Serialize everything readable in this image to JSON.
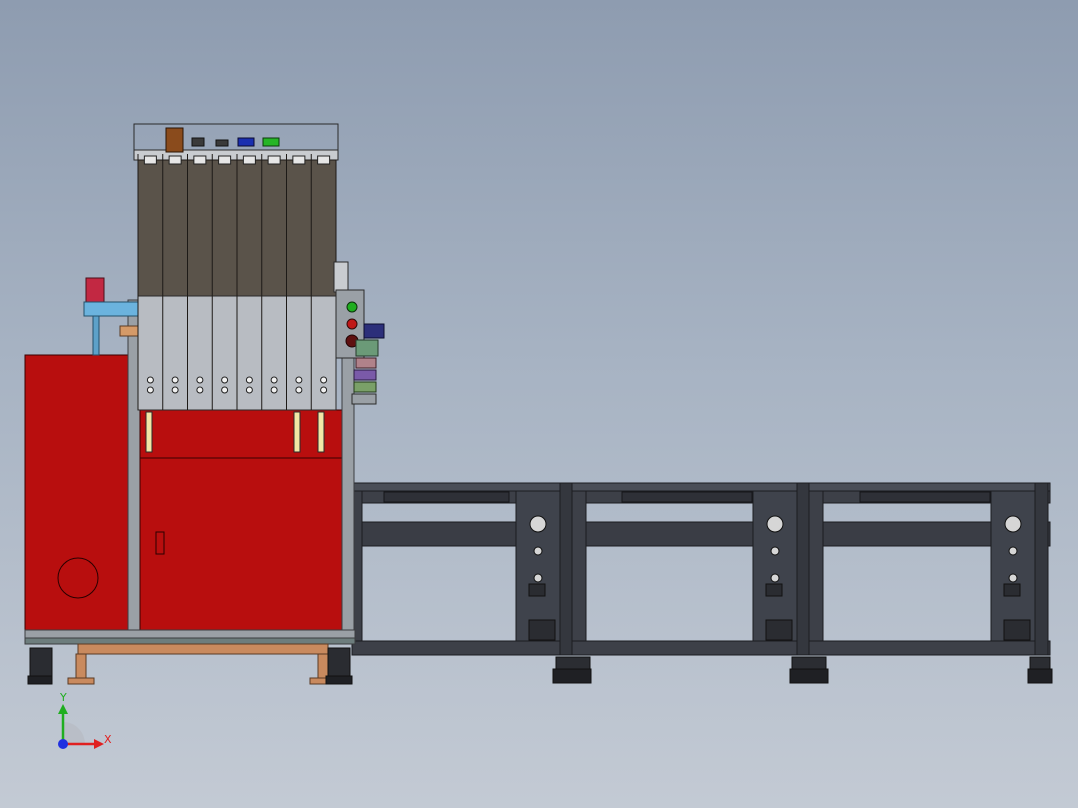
{
  "triad": {
    "x_label": "X",
    "y_label": "Y",
    "x_color": "#e02020",
    "y_color": "#1fae1f",
    "z_color": "#2030e0"
  },
  "model": {
    "frame_color": "#b80e0e",
    "rail_color": "#3d4048",
    "panel_color": "#5a534a"
  }
}
